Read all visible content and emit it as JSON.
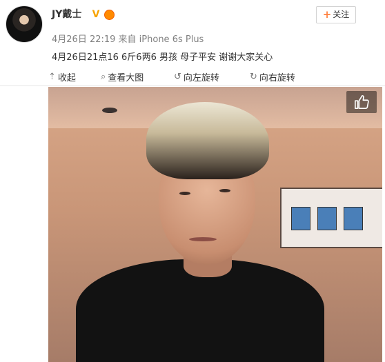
{
  "user": {
    "name": "JY戴士",
    "verified_mark": "V"
  },
  "follow_button": {
    "plus": "+",
    "label": "关注"
  },
  "post": {
    "meta": "4月26日 22:19 来自 iPhone 6s Plus",
    "text": "4月26日21点16 6斤6两6 男孩 母子平安 谢谢大家关心"
  },
  "toolbar": {
    "collapse": "收起",
    "view_large": "查看大图",
    "rotate_left": "向左旋转",
    "rotate_right": "向右旋转"
  },
  "icons": {
    "collapse": "arrow-up-icon",
    "view_large": "magnifier-icon",
    "rotate_left": "rotate-left-icon",
    "rotate_right": "rotate-right-icon",
    "like": "thumbs-up-icon"
  },
  "colors": {
    "follow_plus": "#ff8140",
    "verified": "#f7a300",
    "meta_text": "#808080"
  }
}
